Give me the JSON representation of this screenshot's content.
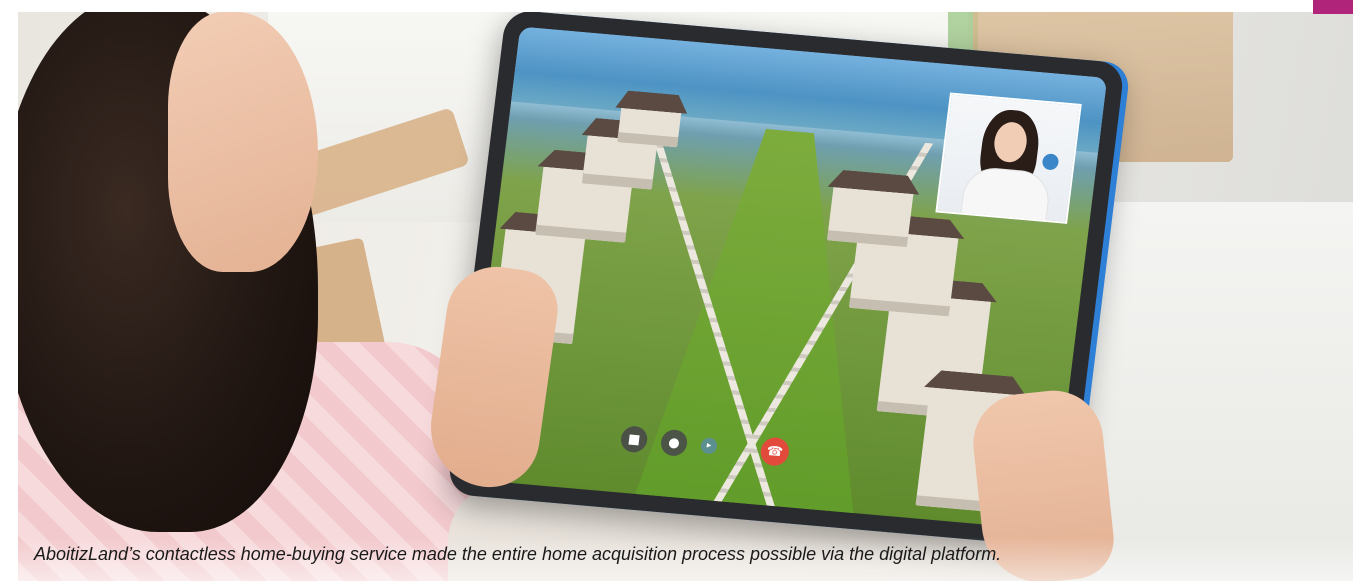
{
  "caption": {
    "text": "AboitizLand’s contactless home-buying service made  the entire home acquisition process possible via the digital platform."
  },
  "video_call": {
    "controls": [
      {
        "name": "camera-icon",
        "glyph": "■"
      },
      {
        "name": "microphone-icon",
        "glyph": "●"
      },
      {
        "name": "volume-icon",
        "glyph": "▸"
      },
      {
        "name": "end-call-icon",
        "glyph": "☎"
      }
    ]
  },
  "colors": {
    "accent_tab": "#b0247a",
    "end_call": "#e24a3c",
    "tablet_case": "#2e7fd6"
  }
}
